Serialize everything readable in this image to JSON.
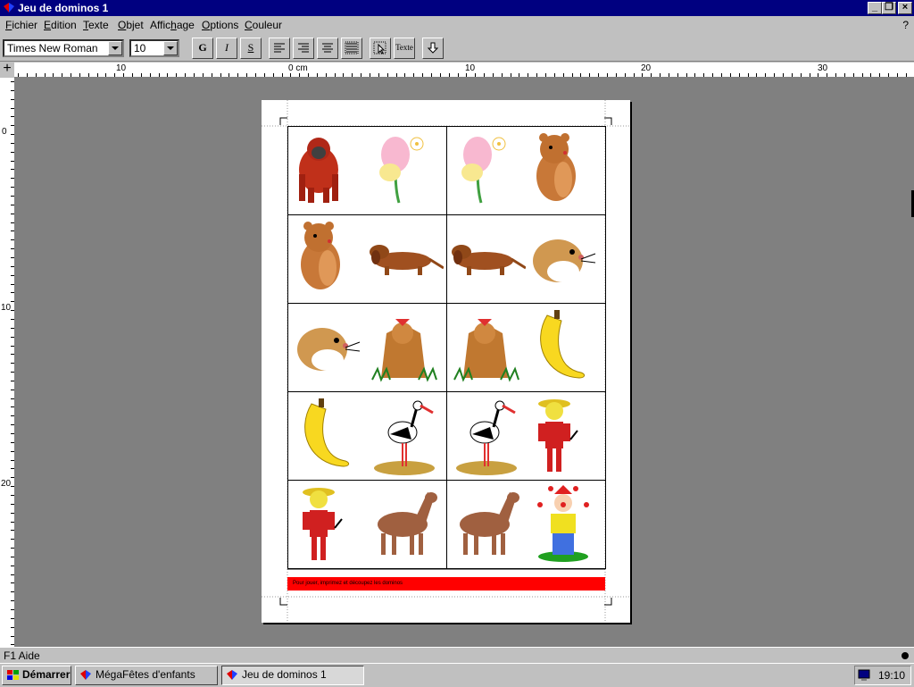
{
  "window": {
    "title": "Jeu de dominos 1",
    "help_glyph": "?"
  },
  "menu": [
    {
      "accel": "F",
      "rest": "ichier"
    },
    {
      "accel": "E",
      "rest": "dition"
    },
    {
      "accel": "T",
      "rest": "exte",
      "pre": ""
    },
    {
      "accel": "O",
      "rest": "bjet"
    },
    {
      "pre": "Affic",
      "accel": "h",
      "rest": "age"
    },
    {
      "accel": "O",
      "rest": "ptions"
    },
    {
      "accel": "C",
      "rest": "ouleur"
    }
  ],
  "toolbar": {
    "font_family": "Times New Roman",
    "font_size": "10",
    "bold_label": "G",
    "italic_label": "I",
    "shadow_label": "S",
    "text_tool_label": "Texte"
  },
  "ruler": {
    "h_labels": [
      "10",
      "0 cm",
      "10",
      "20",
      "30"
    ],
    "v_labels": [
      "0",
      "10",
      "20"
    ]
  },
  "document": {
    "dominoes": [
      {
        "left": "orangutan",
        "right": "flower"
      },
      {
        "left": "flower",
        "right": "bear"
      },
      {
        "left": "bear",
        "right": "dachshund"
      },
      {
        "left": "dachshund",
        "right": "hamster"
      },
      {
        "left": "hamster",
        "right": "yorkshire-dog"
      },
      {
        "left": "yorkshire-dog",
        "right": "banana"
      },
      {
        "left": "banana",
        "right": "stork"
      },
      {
        "left": "stork",
        "right": "farmer"
      },
      {
        "left": "farmer",
        "right": "foal"
      },
      {
        "left": "foal",
        "right": "clown"
      }
    ],
    "footer_text": "Pour jouer, imprimez et découpez les dominos"
  },
  "status": {
    "text": "F1 Aide"
  },
  "taskbar": {
    "start_label": "Démarrer",
    "tasks": [
      "MégaFêtes d'enfants",
      "Jeu de dominos 1"
    ],
    "clock": "19:10"
  },
  "colors": {
    "title_bar": "#000080",
    "workspace": "#808080",
    "banner": "#ff0000"
  }
}
